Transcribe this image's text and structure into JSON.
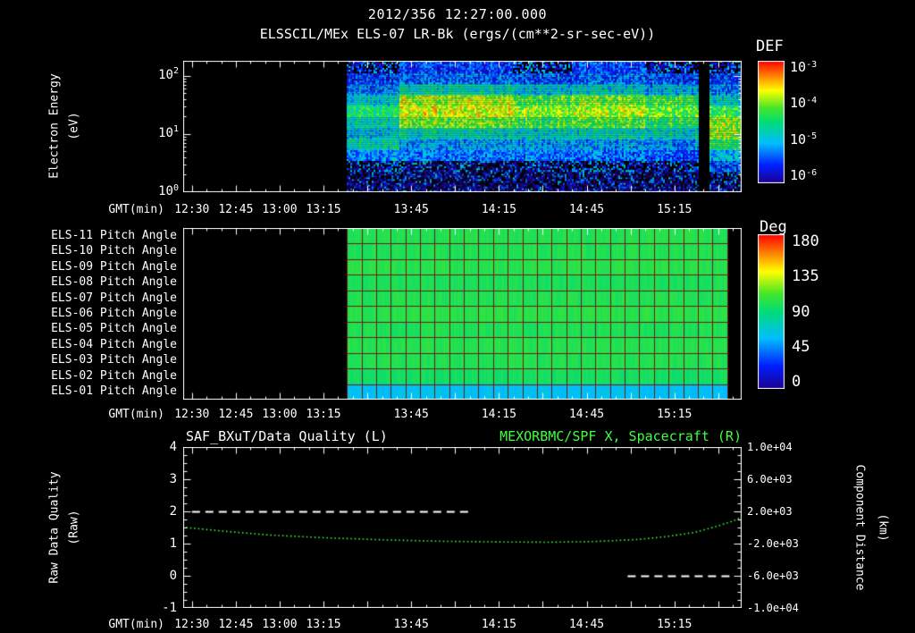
{
  "header": {
    "timestamp": "2012/356 12:27:00.000",
    "title": "ELSSCIL/MEx ELS-07 LR-Bk  (ergs/(cm**2-sr-sec-eV))"
  },
  "colors": {
    "background": "#000000",
    "text": "#ffffff",
    "series_green": "#3fff3f",
    "quality_white": "#ffffff",
    "grid_line_dark_red": "#701c14"
  },
  "time_axis": {
    "label": "GMT(min)",
    "start_clock": "12:27",
    "total_minutes": 191,
    "minor_tick_minutes": 5,
    "major_tick_minutes": 15,
    "ticks": [
      {
        "minute": 3,
        "label": "12:30"
      },
      {
        "minute": 18,
        "label": "12:45"
      },
      {
        "minute": 33,
        "label": "13:00"
      },
      {
        "minute": 48,
        "label": "13:15"
      },
      {
        "minute": 78,
        "label": "13:45"
      },
      {
        "minute": 108,
        "label": "14:15"
      },
      {
        "minute": 138,
        "label": "14:45"
      },
      {
        "minute": 168,
        "label": "15:15"
      }
    ]
  },
  "spectrogram_panel": {
    "ylabel_line1": "Electron Energy",
    "ylabel_line2": "(eV)",
    "ytick_labels": [
      "10^0",
      "10^1",
      "10^2"
    ],
    "colorbar_title": "DEF",
    "colorbar_tick_labels": [
      "10^-3",
      "10^-4",
      "10^-5",
      "10^-6"
    ]
  },
  "pitch_panel": {
    "row_labels": [
      "ELS-11 Pitch Angle",
      "ELS-10 Pitch Angle",
      "ELS-09 Pitch Angle",
      "ELS-08 Pitch Angle",
      "ELS-07 Pitch Angle",
      "ELS-06 Pitch Angle",
      "ELS-05 Pitch Angle",
      "ELS-04 Pitch Angle",
      "ELS-03 Pitch Angle",
      "ELS-02 Pitch Angle",
      "ELS-01 Pitch Angle"
    ],
    "colorbar_title": "Deg",
    "colorbar_tick_labels": [
      "180",
      "135",
      "90",
      "45",
      "0"
    ]
  },
  "line_panel": {
    "title_left": "SAF_BXuT/Data Quality (L)",
    "title_right": "MEXORBMC/SPF X, Spacecraft (R)",
    "ylabel_left_line1": "Raw Data Quality",
    "ylabel_left_line2": "(Raw)",
    "ylabel_right_line1": "Component Distance",
    "ylabel_right_line2": "(km)",
    "ytick_labels_left": [
      "4",
      "3",
      "2",
      "1",
      "0",
      "-1"
    ],
    "ytick_labels_right": [
      "1.0e+04",
      "6.0e+03",
      "2.0e+03",
      "-2.0e+03",
      "-6.0e+03",
      "-1.0e+04"
    ]
  },
  "chart_data": [
    {
      "type": "heatmap",
      "name": "electron-energy-spectrogram",
      "title": "ELSSCIL/MEx ELS-07 LR-Bk",
      "units": "ergs/(cm**2-sr-sec-eV)",
      "xlabel": "GMT(min)",
      "ylabel": "Electron Energy (eV)",
      "yscale": "log",
      "ylim_ev": [
        1,
        180
      ],
      "value_scale": "log10(DEF)",
      "value_range": [
        -6,
        -3
      ],
      "colormap": "rainbow",
      "no_data_before_min": 56,
      "data_gap_min": [
        176,
        180
      ],
      "energy_bin_centers_ev": [
        1.2,
        1.9,
        2.9,
        4.5,
        6.9,
        10.6,
        16.4,
        25,
        39,
        59,
        91,
        143
      ],
      "time_segments": [
        {
          "start_min": 56,
          "end_min": 74,
          "log10_def_by_energy": [
            -5.9,
            -5.8,
            -5.6,
            -5.2,
            -4.7,
            -4.9,
            -4.7,
            -4.5,
            -4.8,
            -5.2,
            -5.5,
            -5.6
          ]
        },
        {
          "start_min": 74,
          "end_min": 113,
          "log10_def_by_energy": [
            -5.9,
            -5.8,
            -5.6,
            -5.3,
            -5.1,
            -4.7,
            -4.1,
            -3.8,
            -3.9,
            -4.7,
            -5.3,
            -5.5
          ]
        },
        {
          "start_min": 113,
          "end_min": 133,
          "log10_def_by_energy": [
            -5.9,
            -5.8,
            -5.7,
            -5.3,
            -5.1,
            -4.8,
            -4.3,
            -4.0,
            -4.2,
            -4.9,
            -5.4,
            -5.6
          ]
        },
        {
          "start_min": 133,
          "end_min": 158,
          "log10_def_by_energy": [
            -5.9,
            -5.8,
            -5.6,
            -5.3,
            -5.1,
            -4.7,
            -4.2,
            -3.9,
            -4.1,
            -4.8,
            -5.3,
            -5.5
          ]
        },
        {
          "start_min": 158,
          "end_min": 176,
          "log10_def_by_energy": [
            -5.9,
            -5.8,
            -5.7,
            -5.4,
            -5.2,
            -4.8,
            -4.4,
            -4.1,
            -4.3,
            -5.0,
            -5.4,
            -5.6
          ]
        },
        {
          "start_min": 180,
          "end_min": 191,
          "log10_def_by_energy": [
            -5.8,
            -5.6,
            -5.4,
            -5.0,
            -4.4,
            -4.0,
            -4.0,
            -4.3,
            -4.8,
            -5.2,
            -5.5,
            -5.6
          ]
        }
      ]
    },
    {
      "type": "heatmap",
      "name": "pitch-angle-panels",
      "rows_top_to_bottom": [
        "ELS-11",
        "ELS-10",
        "ELS-09",
        "ELS-08",
        "ELS-07",
        "ELS-06",
        "ELS-05",
        "ELS-04",
        "ELS-03",
        "ELS-02",
        "ELS-01"
      ],
      "value_units": "degrees",
      "value_range": [
        0,
        180
      ],
      "colormap": "rainbow",
      "data_start_min": 56,
      "data_end_min": 186,
      "pitch_angle_deg_by_row": [
        100,
        100,
        102,
        98,
        100,
        102,
        99,
        101,
        100,
        96,
        62
      ]
    },
    {
      "type": "line",
      "name": "quality-and-distance",
      "xlabel": "GMT(min)",
      "ylim_left": [
        -1,
        4
      ],
      "ylim_right": [
        -10000,
        10000
      ],
      "series": [
        {
          "name": "SAF_BXuT/Data Quality (L)",
          "axis": "left",
          "color": "#ffffff",
          "style": "dashed",
          "segments": [
            {
              "value": 2,
              "start_min": 3,
              "end_min": 98
            },
            {
              "value": 0,
              "start_min": 152,
              "end_min": 187
            }
          ]
        },
        {
          "name": "MEXORBMC/SPF X, Spacecraft (R)",
          "axis": "right",
          "color": "#3fff3f",
          "style": "dotted",
          "points_min_km": [
            [
              1,
              0
            ],
            [
              15,
              -500
            ],
            [
              30,
              -950
            ],
            [
              50,
              -1300
            ],
            [
              70,
              -1550
            ],
            [
              90,
              -1720
            ],
            [
              110,
              -1800
            ],
            [
              125,
              -1830
            ],
            [
              140,
              -1750
            ],
            [
              155,
              -1500
            ],
            [
              165,
              -1150
            ],
            [
              175,
              -600
            ],
            [
              183,
              200
            ],
            [
              188,
              800
            ],
            [
              191,
              1300
            ]
          ]
        }
      ]
    }
  ]
}
